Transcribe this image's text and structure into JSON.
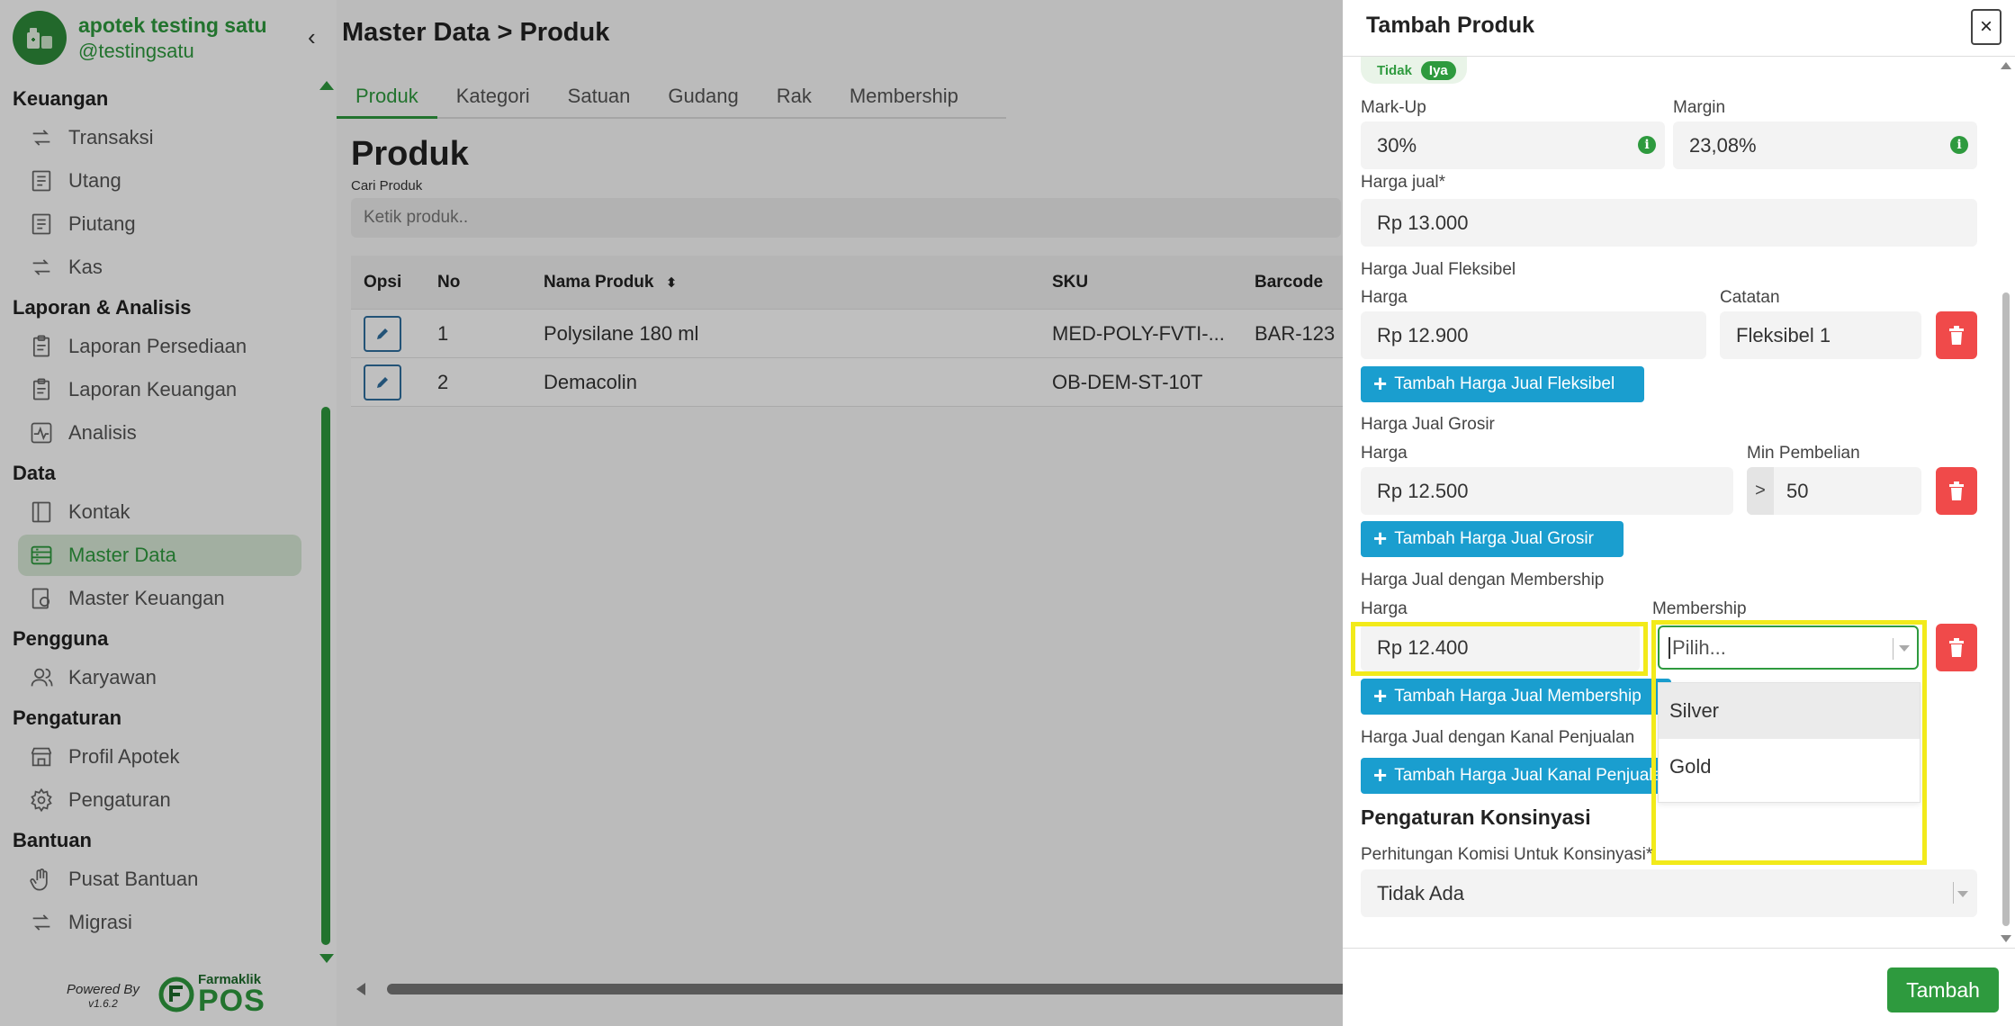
{
  "app": {
    "name": "apotek testing satu",
    "handle": "@testingsatu"
  },
  "sidebar": {
    "sections": [
      {
        "title": "Keuangan",
        "items": [
          {
            "label": "Transaksi",
            "icon": "transfer-icon"
          },
          {
            "label": "Utang",
            "icon": "document-icon"
          },
          {
            "label": "Piutang",
            "icon": "document-icon"
          },
          {
            "label": "Kas",
            "icon": "transfer-icon"
          }
        ]
      },
      {
        "title": "Laporan & Analisis",
        "items": [
          {
            "label": "Laporan Persediaan",
            "icon": "clipboard-icon"
          },
          {
            "label": "Laporan Keuangan",
            "icon": "clipboard-icon"
          },
          {
            "label": "Analisis",
            "icon": "pulse-icon"
          }
        ]
      },
      {
        "title": "Data",
        "items": [
          {
            "label": "Kontak",
            "icon": "contact-book-icon"
          },
          {
            "label": "Master Data",
            "icon": "database-icon",
            "active": true
          },
          {
            "label": "Master Keuangan",
            "icon": "money-doc-icon"
          }
        ]
      },
      {
        "title": "Pengguna",
        "items": [
          {
            "label": "Karyawan",
            "icon": "users-icon"
          }
        ]
      },
      {
        "title": "Pengaturan",
        "items": [
          {
            "label": "Profil Apotek",
            "icon": "store-icon"
          },
          {
            "label": "Pengaturan",
            "icon": "gear-icon"
          }
        ]
      },
      {
        "title": "Bantuan",
        "items": [
          {
            "label": "Pusat Bantuan",
            "icon": "hand-icon"
          },
          {
            "label": "Migrasi",
            "icon": "transfer-icon"
          }
        ]
      }
    ],
    "powered_by": "Powered By",
    "version": "v1.6.2",
    "brand_top": "Farmaklik",
    "brand_bottom": "POS"
  },
  "main": {
    "breadcrumb": "Master Data > Produk",
    "tabs": [
      "Produk",
      "Kategori",
      "Satuan",
      "Gudang",
      "Rak",
      "Membership"
    ],
    "active_tab": "Produk",
    "section_title": "Produk",
    "search_label": "Cari Produk",
    "search_placeholder": "Ketik produk..",
    "table": {
      "columns": [
        "Opsi",
        "No",
        "Nama Produk",
        "SKU",
        "Barcode"
      ],
      "rows": [
        {
          "no": "1",
          "nama": "Polysilane 180 ml",
          "sku": "MED-POLY-FVTI-...",
          "barcode": "BAR-123"
        },
        {
          "no": "2",
          "nama": "Demacolin",
          "sku": "OB-DEM-ST-10T",
          "barcode": ""
        }
      ]
    }
  },
  "modal": {
    "title": "Tambah Produk",
    "close": "×",
    "toggle": {
      "off": "Tidak",
      "on": "Iya"
    },
    "markup": {
      "label": "Mark-Up",
      "value": "30%"
    },
    "margin": {
      "label": "Margin",
      "value": "23,08%"
    },
    "harga_jual": {
      "label": "Harga jual*",
      "value": "Rp 13.000"
    },
    "fleksibel": {
      "title": "Harga Jual Fleksibel",
      "harga_label": "Harga",
      "harga_value": "Rp 12.900",
      "catatan_label": "Catatan",
      "catatan_value": "Fleksibel 1",
      "add_label": "Tambah Harga Jual Fleksibel"
    },
    "grosir": {
      "title": "Harga Jual Grosir",
      "harga_label": "Harga",
      "harga_value": "Rp 12.500",
      "min_label": "Min Pembelian",
      "min_prefix": ">",
      "min_value": "50",
      "add_label": "Tambah Harga Jual Grosir"
    },
    "membership": {
      "title": "Harga Jual dengan Membership",
      "harga_label": "Harga",
      "harga_value": "Rp 12.400",
      "membership_label": "Membership",
      "membership_placeholder": "Pilih...",
      "options": [
        "Silver",
        "Gold"
      ],
      "add_label": "Tambah Harga Jual Membership"
    },
    "kanal": {
      "title": "Harga Jual dengan Kanal Penjualan",
      "add_label": "Tambah Harga Jual Kanal Penjualan"
    },
    "konsinyasi": {
      "title": "Pengaturan Konsinyasi",
      "komisi_label": "Perhitungan Komisi Untuk Konsinyasi*",
      "komisi_value": "Tidak Ada"
    },
    "submit": "Tambah"
  },
  "colors": {
    "brand_green": "#2e9a3e",
    "action_blue": "#1a9ecf",
    "danger_red": "#f04a4a",
    "highlight_yellow": "#f2ea1a"
  }
}
